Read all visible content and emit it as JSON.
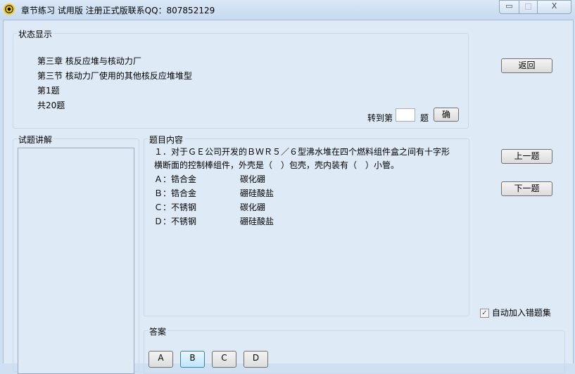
{
  "window": {
    "title": "章节练习 试用版  注册正式版联系QQ：807852129",
    "minimize": "▭",
    "maximize": "□",
    "close": "X"
  },
  "status": {
    "label": "状态显示",
    "chapter": "第三章 核反应堆与核动力厂",
    "section": "第三节 核动力厂使用的其他核反应堆堆型",
    "question_no": "第1题",
    "total": "共20题",
    "goto_prefix": "转到第",
    "goto_value": "",
    "goto_suffix": "题",
    "goto_button": "确"
  },
  "buttons": {
    "back": "返回",
    "prev": "上一题",
    "next": "下一题"
  },
  "explain": {
    "label": "试题讲解"
  },
  "question": {
    "label": "题目内容",
    "line1": "１．对于ＧＥ公司开发的ＢＷＲ５／６型沸水堆在四个燃料组件盒之间有十字形",
    "line2": "横断面的控制棒组件，外壳是（　）包壳，壳内装有（　）小管。",
    "options": [
      {
        "key": "Ａ：",
        "a": "锆合金",
        "b": "碳化硼"
      },
      {
        "key": "Ｂ：",
        "a": "锆合金",
        "b": "硼硅酸盐"
      },
      {
        "key": "Ｃ：",
        "a": "不锈钢",
        "b": "碳化硼"
      },
      {
        "key": "Ｄ：",
        "a": "不锈钢",
        "b": "硼硅酸盐"
      }
    ]
  },
  "auto_wrong": {
    "label": "自动加入错题集",
    "checked": true
  },
  "answer": {
    "label": "答案",
    "choices": [
      "A",
      "B",
      "C",
      "D"
    ],
    "focused": "B"
  }
}
